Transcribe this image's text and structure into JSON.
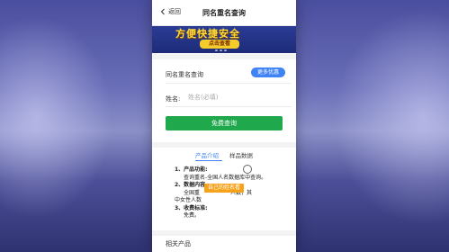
{
  "navbar": {
    "back_label": "返回",
    "title": "同名重名查询"
  },
  "banner": {
    "headline": "方便快捷安全",
    "cta_label": "点击查看"
  },
  "query_card": {
    "heading": "同名重名查询",
    "more_button": "更多优惠",
    "name_label": "姓名:",
    "name_placeholder": "姓名(必填)",
    "name_value": "",
    "submit_button": "免费查询"
  },
  "tabs": [
    {
      "label": "产品介绍",
      "active": true
    },
    {
      "label": "样品数据",
      "active": false
    }
  ],
  "content": {
    "item1_title": "1、产品功能:",
    "item1_text": "查询重名-全国人名数据库中查询。",
    "item2_title": "2、数据内容",
    "item2_text_a": "全国重",
    "item2_text_b": "人数，其",
    "item2_text_c": "中女性人数",
    "item3_title": "3、收费标准:",
    "item3_text": "免费。"
  },
  "tooltip": "自己的姓名看",
  "related": "相关产品",
  "colors": {
    "primary_blue": "#3f83f6",
    "primary_green": "#20a84c",
    "accent_orange": "#f7a21b"
  }
}
